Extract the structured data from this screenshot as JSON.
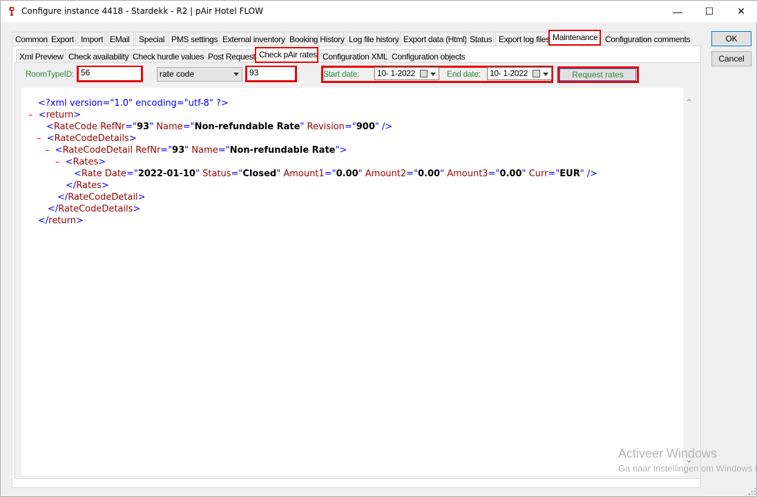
{
  "window": {
    "title": "Configure instance 4418 - Stardekk - R2 | pAir Hotel FLOW",
    "min_glyph": "—",
    "max_glyph": "☐",
    "close_glyph": "✕",
    "icon": "app-icon"
  },
  "top_tabs": [
    {
      "label": "Common"
    },
    {
      "label": "Export"
    },
    {
      "label": "Import"
    },
    {
      "label": "EMail"
    },
    {
      "label": "Special"
    },
    {
      "label": "PMS settings"
    },
    {
      "label": "External inventory"
    },
    {
      "label": "Booking History"
    },
    {
      "label": "Log file history"
    },
    {
      "label": "Export data (Html)"
    },
    {
      "label": "Status"
    },
    {
      "label": "Export log files"
    },
    {
      "label": "Maintenance"
    },
    {
      "label": "Configuration comments"
    }
  ],
  "sub_tabs": [
    {
      "label": "Xml Preview"
    },
    {
      "label": "Check availability"
    },
    {
      "label": "Check hurdle values"
    },
    {
      "label": "Post Request"
    },
    {
      "label": "Check pAir rates"
    },
    {
      "label": "Configuration XML"
    },
    {
      "label": "Configuration objects"
    }
  ],
  "form": {
    "room_type_label": "RoomTypeID:",
    "room_type_value": "56",
    "code_type_value": "rate code",
    "code_value": "93",
    "start_date_label": "Start date:",
    "start_date_value": "10-  1-2022",
    "end_date_label": "End date:",
    "end_date_value": "10-  1-2022",
    "request_button": "Request rates"
  },
  "side_buttons": {
    "ok": "OK",
    "cancel": "Cancel"
  },
  "xml": {
    "l1": "<?xml version=\"1.0\" encoding=\"utf-8\" ?>",
    "minus": "–",
    "return_tag": "return",
    "ratecode_tag": "RateCode",
    "refnr_attr": "RefNr",
    "refnr_val": "93",
    "name_attr": "Name",
    "name_val": "Non-refundable Rate",
    "revision_attr": "Revision",
    "revision_val": "900",
    "ratecodedetails_tag": "RateCodeDetails",
    "ratecodedetail_tag": "RateCodeDetail",
    "rates_tag": "Rates",
    "rate_tag": "Rate",
    "date_attr": "Date",
    "date_val": "2022-01-10",
    "status_attr": "Status",
    "status_val": "Closed",
    "amount1_attr": "Amount1",
    "amount1_val": "0.00",
    "amount2_attr": "Amount2",
    "amount2_val": "0.00",
    "amount3_attr": "Amount3",
    "amount3_val": "0.00",
    "curr_attr": "Curr",
    "curr_val": "EUR"
  },
  "watermark": {
    "line1": "Activeer Windows",
    "line2": "Ga naar Instellingen om Windows te activeren."
  },
  "colors": {
    "highlight": "#e60000",
    "label_green": "#2e8b3d",
    "xml_blue": "#0000ff",
    "xml_red": "#990000"
  }
}
